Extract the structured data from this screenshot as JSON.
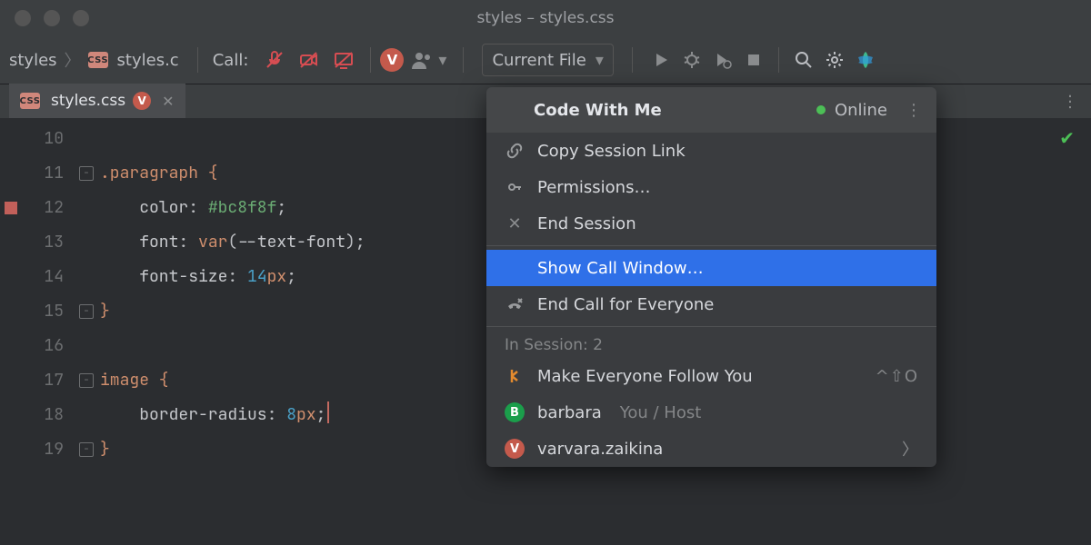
{
  "window": {
    "title": "styles – styles.css"
  },
  "breadcrumb": {
    "root": "styles",
    "file": "styles.c"
  },
  "toolbar": {
    "call_label": "Call:",
    "avatar_letter": "V",
    "run_config": "Current File"
  },
  "tab": {
    "filename": "styles.css",
    "avatar_letter": "V"
  },
  "gutter": [
    "10",
    "11",
    "12",
    "13",
    "14",
    "15",
    "16",
    "17",
    "18",
    "19"
  ],
  "code": {
    "l11_selector": ".paragraph",
    "l12_prop": "color",
    "l12_val": "#bc8f8f",
    "l13_prop": "font",
    "l13_fn": "var",
    "l13_arg": "--text-font",
    "l14_prop": "font-size",
    "l14_num": "14",
    "l14_unit": "px",
    "l17_selector": "image",
    "l18_prop": "border-radius",
    "l18_num": "8",
    "l18_unit": "px"
  },
  "popup": {
    "title": "Code With Me",
    "status": "Online",
    "items": {
      "copy": "Copy Session Link",
      "perm": "Permissions…",
      "end_session": "End Session",
      "show_call": "Show Call Window…",
      "end_call": "End Call for Everyone",
      "session_heading": "In Session: 2",
      "follow": "Make Everyone Follow You",
      "follow_shortcut": "^⇧O",
      "user_b_letter": "B",
      "user_b_name": "barbara",
      "user_b_role": "You / Host",
      "user_v_letter": "V",
      "user_v_name": "varvara.zaikina"
    }
  }
}
